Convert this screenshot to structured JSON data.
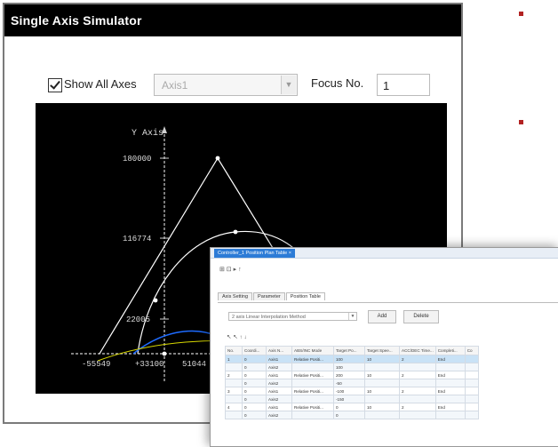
{
  "window": {
    "title": "Single Axis Simulator",
    "show_all_axes_label": "Show All Axes",
    "show_all_axes_checked": true,
    "axis_select_value": "Axis1",
    "focus_label": "Focus No.",
    "focus_value": "1"
  },
  "plot": {
    "y_axis_label": "Y Axis",
    "y_ticks": [
      "180000",
      "116774",
      "22005"
    ],
    "x_ticks": [
      "-55549",
      "+33100",
      "51044"
    ],
    "colors": {
      "background": "#000000",
      "axes": "#cfcfcf",
      "path": "#ffffff",
      "path2": "#1e6bff",
      "path3": "#d7d700"
    }
  },
  "bullets": {
    "color": "#b22222"
  },
  "overlay": {
    "tab_title": "Controller_1 Position Plan Table",
    "toolbar": "⊞ ⊡ ▸ ↑",
    "subtabs": [
      "Axis Setting",
      "Parameter",
      "Position Table"
    ],
    "active_subtab": 2,
    "mode_dropdown": "2 axis Linear Interpolation Method",
    "add_label": "Add",
    "delete_label": "Delete",
    "row_icons": "↖ ↖ ↑ ↓",
    "columns": [
      "No.",
      "Coordi...",
      "Axis N...",
      "ABS/INC Mode",
      "Target Po...",
      "Target Spee...",
      "ACC/DEC Time...",
      "Completi...",
      "Co"
    ],
    "rows": [
      [
        "1",
        "0",
        "Axis1",
        "Relative Positi...",
        "100",
        "10",
        "2",
        "End",
        ""
      ],
      [
        "",
        "0",
        "Axis2",
        "",
        "100",
        "",
        "",
        "",
        ""
      ],
      [
        "2",
        "0",
        "Axis1",
        "Relative Positi...",
        "200",
        "10",
        "2",
        "End",
        ""
      ],
      [
        "",
        "0",
        "Axis2",
        "",
        "-50",
        "",
        "",
        "",
        ""
      ],
      [
        "3",
        "0",
        "Axis1",
        "Relative Positi...",
        "-100",
        "10",
        "2",
        "End",
        ""
      ],
      [
        "",
        "0",
        "Axis2",
        "",
        "-150",
        "",
        "",
        "",
        ""
      ],
      [
        "4",
        "0",
        "Axis1",
        "Relative Positi...",
        "0",
        "10",
        "2",
        "End",
        ""
      ],
      [
        "",
        "0",
        "Axis2",
        "",
        "0",
        "",
        "",
        "",
        ""
      ]
    ]
  }
}
